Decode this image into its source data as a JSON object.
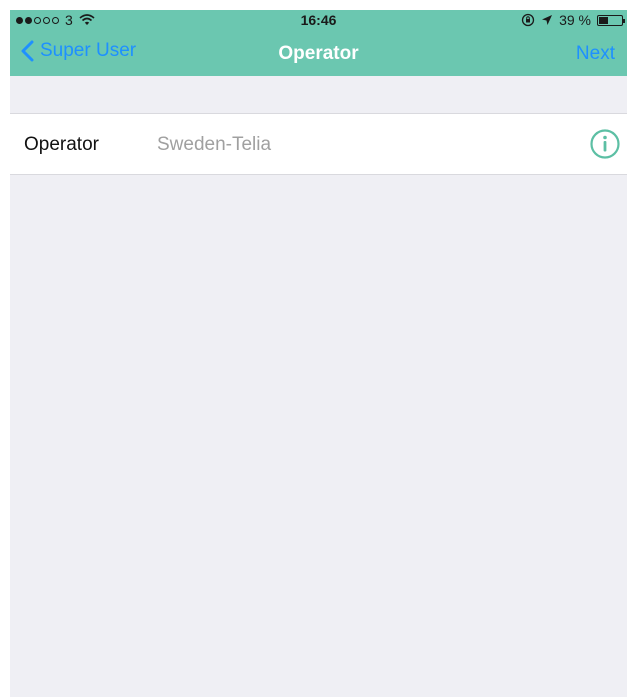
{
  "status_bar": {
    "carrier": "3",
    "time": "16:46",
    "battery_percent": "39 %",
    "battery_level": 0.39,
    "signal_bars_filled": 2,
    "signal_bars_total": 5
  },
  "nav": {
    "back_label": "Super User",
    "title": "Operator",
    "next_label": "Next"
  },
  "operator_row": {
    "label": "Operator",
    "value": "Sweden-Telia"
  },
  "colors": {
    "header": "#6bc7b0",
    "link": "#1e90ff",
    "info_icon": "#5cbfa4",
    "background": "#efeff4"
  }
}
